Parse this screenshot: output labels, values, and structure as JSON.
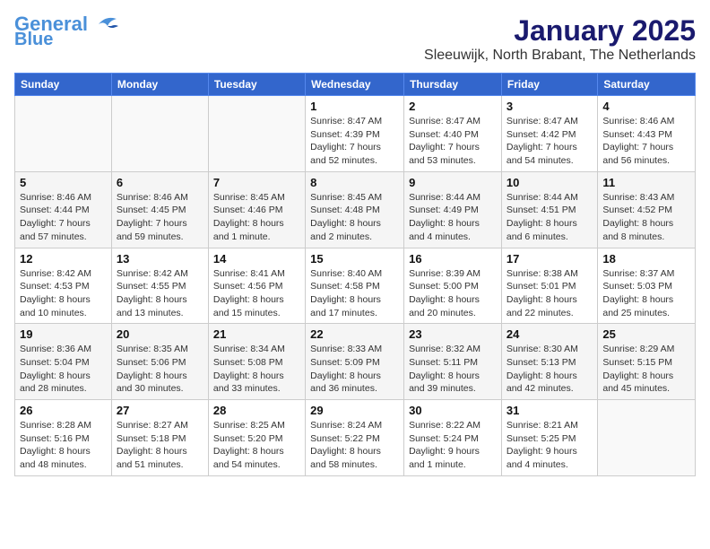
{
  "logo": {
    "line1": "General",
    "line2": "Blue"
  },
  "title": "January 2025",
  "location": "Sleeuwijk, North Brabant, The Netherlands",
  "days_of_week": [
    "Sunday",
    "Monday",
    "Tuesday",
    "Wednesday",
    "Thursday",
    "Friday",
    "Saturday"
  ],
  "weeks": [
    [
      {
        "day": "",
        "info": ""
      },
      {
        "day": "",
        "info": ""
      },
      {
        "day": "",
        "info": ""
      },
      {
        "day": "1",
        "info": "Sunrise: 8:47 AM\nSunset: 4:39 PM\nDaylight: 7 hours and 52 minutes."
      },
      {
        "day": "2",
        "info": "Sunrise: 8:47 AM\nSunset: 4:40 PM\nDaylight: 7 hours and 53 minutes."
      },
      {
        "day": "3",
        "info": "Sunrise: 8:47 AM\nSunset: 4:42 PM\nDaylight: 7 hours and 54 minutes."
      },
      {
        "day": "4",
        "info": "Sunrise: 8:46 AM\nSunset: 4:43 PM\nDaylight: 7 hours and 56 minutes."
      }
    ],
    [
      {
        "day": "5",
        "info": "Sunrise: 8:46 AM\nSunset: 4:44 PM\nDaylight: 7 hours and 57 minutes."
      },
      {
        "day": "6",
        "info": "Sunrise: 8:46 AM\nSunset: 4:45 PM\nDaylight: 7 hours and 59 minutes."
      },
      {
        "day": "7",
        "info": "Sunrise: 8:45 AM\nSunset: 4:46 PM\nDaylight: 8 hours and 1 minute."
      },
      {
        "day": "8",
        "info": "Sunrise: 8:45 AM\nSunset: 4:48 PM\nDaylight: 8 hours and 2 minutes."
      },
      {
        "day": "9",
        "info": "Sunrise: 8:44 AM\nSunset: 4:49 PM\nDaylight: 8 hours and 4 minutes."
      },
      {
        "day": "10",
        "info": "Sunrise: 8:44 AM\nSunset: 4:51 PM\nDaylight: 8 hours and 6 minutes."
      },
      {
        "day": "11",
        "info": "Sunrise: 8:43 AM\nSunset: 4:52 PM\nDaylight: 8 hours and 8 minutes."
      }
    ],
    [
      {
        "day": "12",
        "info": "Sunrise: 8:42 AM\nSunset: 4:53 PM\nDaylight: 8 hours and 10 minutes."
      },
      {
        "day": "13",
        "info": "Sunrise: 8:42 AM\nSunset: 4:55 PM\nDaylight: 8 hours and 13 minutes."
      },
      {
        "day": "14",
        "info": "Sunrise: 8:41 AM\nSunset: 4:56 PM\nDaylight: 8 hours and 15 minutes."
      },
      {
        "day": "15",
        "info": "Sunrise: 8:40 AM\nSunset: 4:58 PM\nDaylight: 8 hours and 17 minutes."
      },
      {
        "day": "16",
        "info": "Sunrise: 8:39 AM\nSunset: 5:00 PM\nDaylight: 8 hours and 20 minutes."
      },
      {
        "day": "17",
        "info": "Sunrise: 8:38 AM\nSunset: 5:01 PM\nDaylight: 8 hours and 22 minutes."
      },
      {
        "day": "18",
        "info": "Sunrise: 8:37 AM\nSunset: 5:03 PM\nDaylight: 8 hours and 25 minutes."
      }
    ],
    [
      {
        "day": "19",
        "info": "Sunrise: 8:36 AM\nSunset: 5:04 PM\nDaylight: 8 hours and 28 minutes."
      },
      {
        "day": "20",
        "info": "Sunrise: 8:35 AM\nSunset: 5:06 PM\nDaylight: 8 hours and 30 minutes."
      },
      {
        "day": "21",
        "info": "Sunrise: 8:34 AM\nSunset: 5:08 PM\nDaylight: 8 hours and 33 minutes."
      },
      {
        "day": "22",
        "info": "Sunrise: 8:33 AM\nSunset: 5:09 PM\nDaylight: 8 hours and 36 minutes."
      },
      {
        "day": "23",
        "info": "Sunrise: 8:32 AM\nSunset: 5:11 PM\nDaylight: 8 hours and 39 minutes."
      },
      {
        "day": "24",
        "info": "Sunrise: 8:30 AM\nSunset: 5:13 PM\nDaylight: 8 hours and 42 minutes."
      },
      {
        "day": "25",
        "info": "Sunrise: 8:29 AM\nSunset: 5:15 PM\nDaylight: 8 hours and 45 minutes."
      }
    ],
    [
      {
        "day": "26",
        "info": "Sunrise: 8:28 AM\nSunset: 5:16 PM\nDaylight: 8 hours and 48 minutes."
      },
      {
        "day": "27",
        "info": "Sunrise: 8:27 AM\nSunset: 5:18 PM\nDaylight: 8 hours and 51 minutes."
      },
      {
        "day": "28",
        "info": "Sunrise: 8:25 AM\nSunset: 5:20 PM\nDaylight: 8 hours and 54 minutes."
      },
      {
        "day": "29",
        "info": "Sunrise: 8:24 AM\nSunset: 5:22 PM\nDaylight: 8 hours and 58 minutes."
      },
      {
        "day": "30",
        "info": "Sunrise: 8:22 AM\nSunset: 5:24 PM\nDaylight: 9 hours and 1 minute."
      },
      {
        "day": "31",
        "info": "Sunrise: 8:21 AM\nSunset: 5:25 PM\nDaylight: 9 hours and 4 minutes."
      },
      {
        "day": "",
        "info": ""
      }
    ]
  ]
}
